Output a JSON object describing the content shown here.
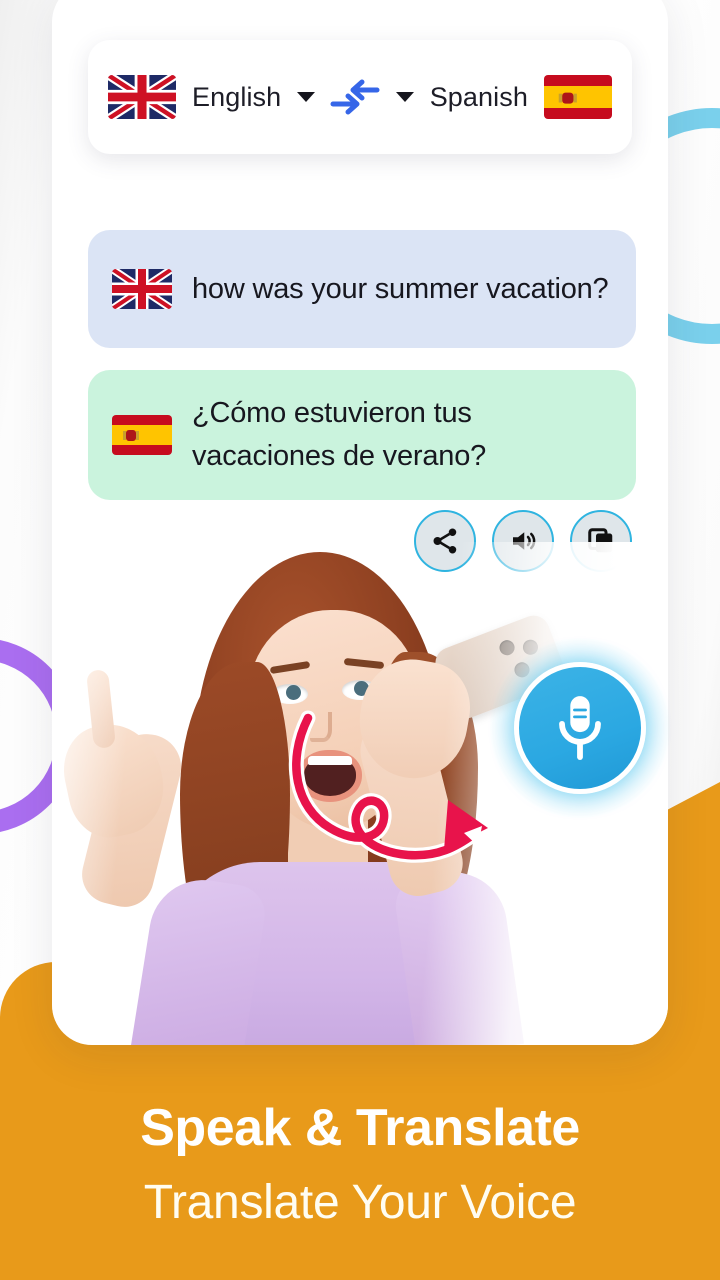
{
  "app": {
    "headline": "Speak & Translate",
    "subheadline": "Translate Your Voice",
    "accent_orange": "#e89a1a",
    "accent_blue": "#2ba8e2",
    "accent_purple": "#a362ef",
    "accent_lightblue": "#73cdeb"
  },
  "language_bar": {
    "source": {
      "name": "English",
      "flag_icon": "flag-uk-icon",
      "caret_icon": "chevron-down-icon"
    },
    "swap_icon": "swap-arrows-icon",
    "target": {
      "name": "Spanish",
      "flag_icon": "flag-spain-icon",
      "caret_icon": "chevron-down-icon"
    }
  },
  "conversation": {
    "source_bubble": {
      "flag_icon": "flag-uk-icon",
      "text": "how was your summer vacation?",
      "bg": "#dbe4f5"
    },
    "target_bubble": {
      "flag_icon": "flag-spain-icon",
      "text": "¿Cómo estuvieron tus vacaciones de verano?",
      "bg": "#caf3dd"
    }
  },
  "actions": [
    {
      "name": "share-button",
      "icon": "share-icon"
    },
    {
      "name": "speak-button",
      "icon": "speaker-icon"
    },
    {
      "name": "copy-button",
      "icon": "copy-icon"
    }
  ],
  "mic": {
    "icon": "microphone-icon",
    "color": "#2ba8e2"
  },
  "annotation": {
    "arrow_icon": "curly-arrow-icon",
    "arrow_color": "#e8134b"
  }
}
